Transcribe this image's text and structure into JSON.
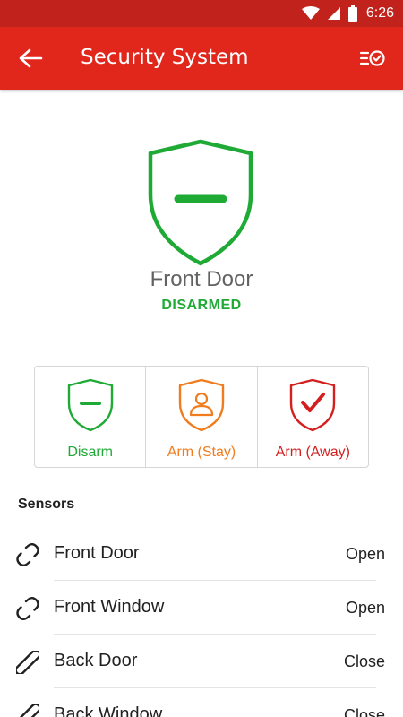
{
  "status_bar": {
    "time": "6:26",
    "icons": [
      "wifi-icon",
      "signal-icon",
      "battery-icon"
    ]
  },
  "app_bar": {
    "title": "Security System",
    "back_icon": "arrow-back-icon",
    "history_icon": "history-list-icon"
  },
  "device": {
    "name": "Front Door",
    "status": "DISARMED",
    "status_color": "#1faa36"
  },
  "modes": [
    {
      "label": "Disarm",
      "color": "#1faa36",
      "icon": "shield-minus-icon"
    },
    {
      "label": "Arm (Stay)",
      "color": "#f07c1e",
      "icon": "shield-person-icon"
    },
    {
      "label": "Arm (Away)",
      "color": "#d3201f",
      "icon": "shield-check-icon"
    }
  ],
  "sensors": {
    "header": "Sensors",
    "items": [
      {
        "name": "Front Door",
        "state": "Open",
        "icon": "link-broken-icon"
      },
      {
        "name": "Front Window",
        "state": "Open",
        "icon": "link-broken-icon"
      },
      {
        "name": "Back Door",
        "state": "Close",
        "icon": "link-icon"
      },
      {
        "name": "Back Window",
        "state": "Close",
        "icon": "link-icon"
      }
    ]
  },
  "colors": {
    "app_bar": "#e1261c",
    "status_bar": "#c1221c"
  }
}
